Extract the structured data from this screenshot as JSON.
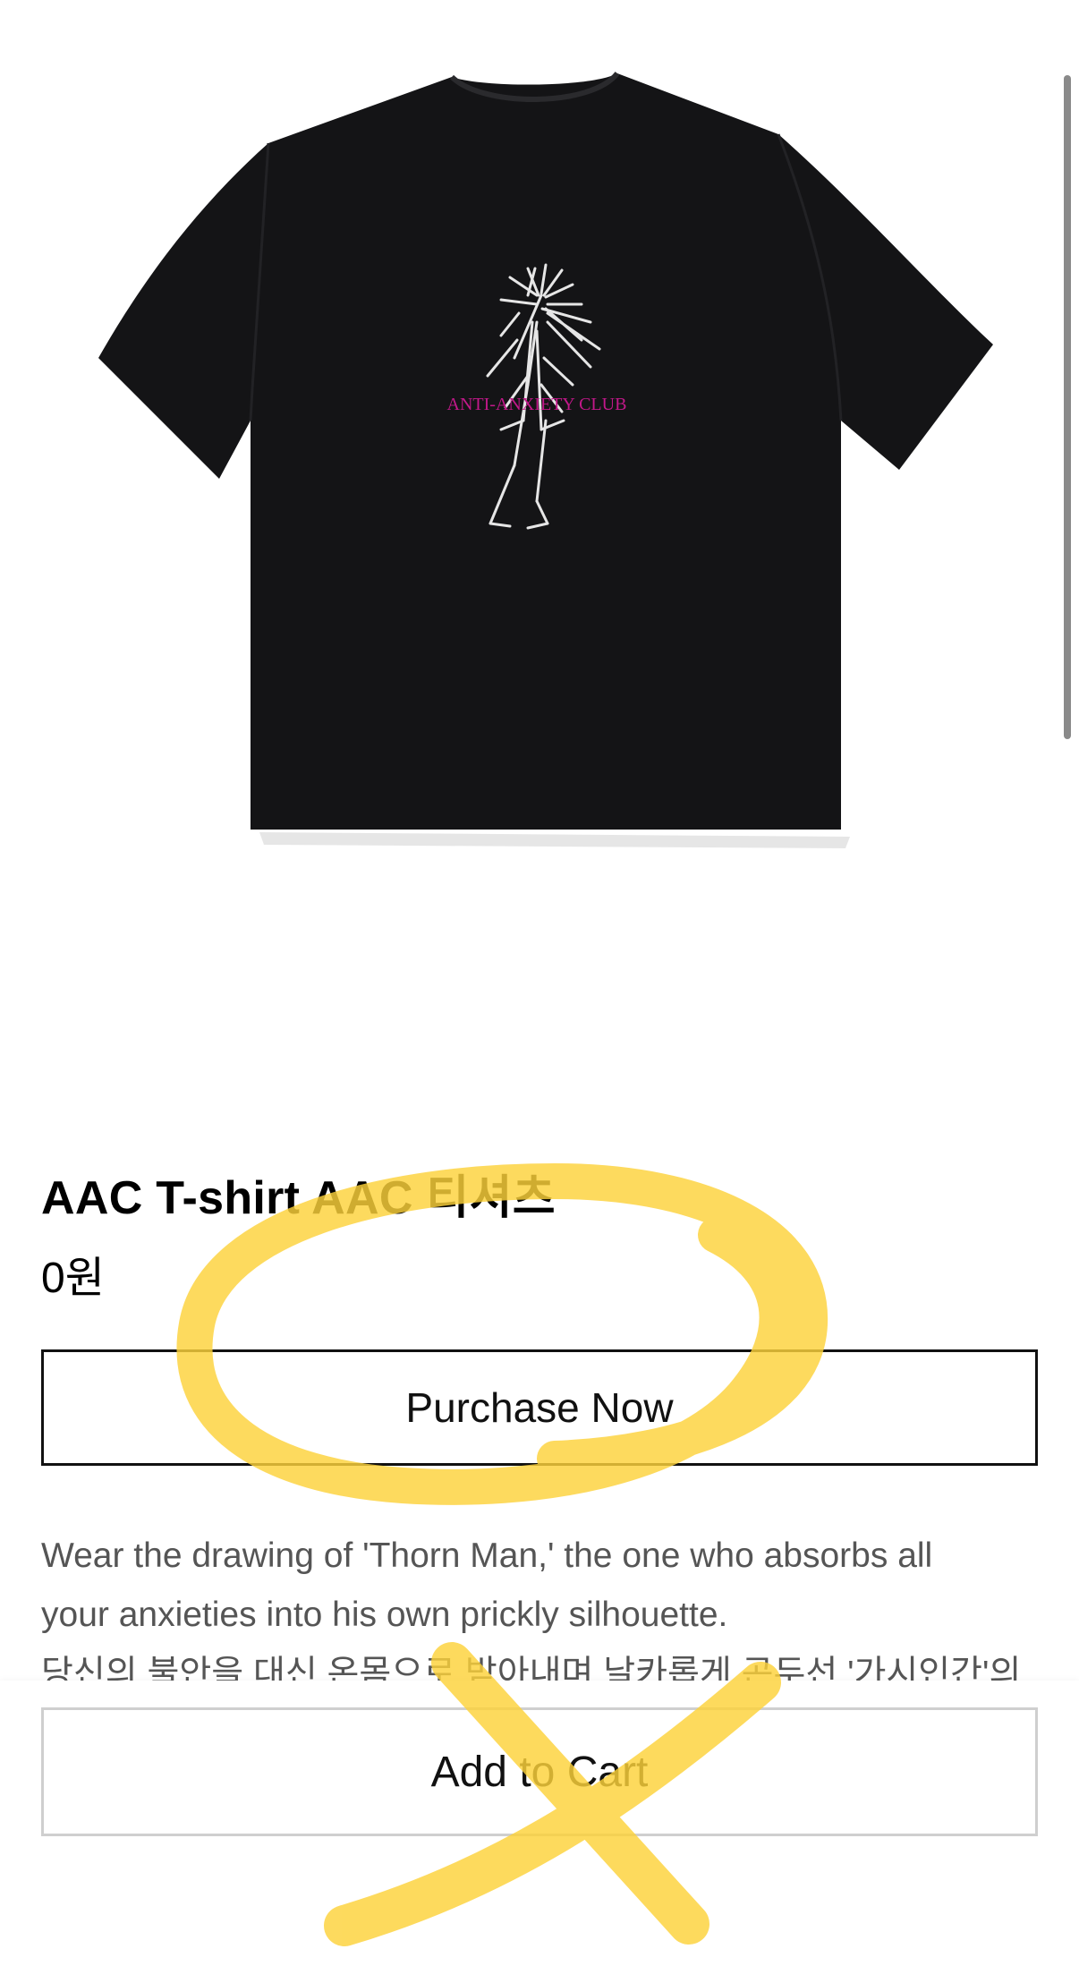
{
  "product": {
    "image_print_text": "ANTI-ANXIETY CLUB",
    "shirt_color": "#141416",
    "print_text_color": "#c2188a",
    "title": "AAC T-shirt AAC 티셔츠",
    "price": "0원"
  },
  "actions": {
    "purchase_label": "Purchase Now",
    "add_to_cart_label": "Add to Cart"
  },
  "description": {
    "line_en_1": "Wear the drawing of 'Thorn Man,' the one who absorbs all",
    "line_en_2": "your anxieties into his own prickly silhouette.",
    "line_ko_1": "당신의 불안을 대신 온몸으로 받아내며 날카롭게 곤두선 '가시인간'의"
  },
  "annotations": {
    "highlight_color": "#fdd23a"
  }
}
